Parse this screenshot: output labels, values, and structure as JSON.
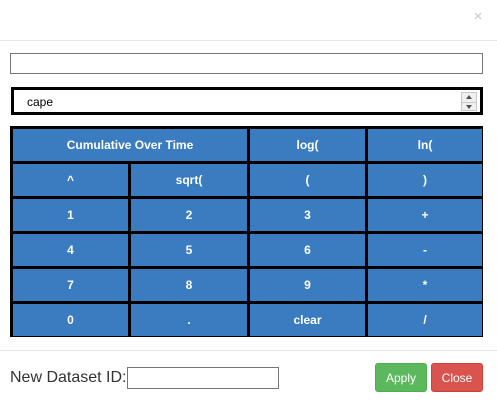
{
  "dialog": {
    "close_glyph": "×"
  },
  "formula": {
    "value": ""
  },
  "dataset_select": {
    "value": "cape"
  },
  "keypad": {
    "keys": [
      {
        "label": "Cumulative Over Time",
        "wide": true
      },
      {
        "label": "log("
      },
      {
        "label": "ln("
      },
      {
        "label": "^"
      },
      {
        "label": "sqrt("
      },
      {
        "label": "("
      },
      {
        "label": ")"
      },
      {
        "label": "1"
      },
      {
        "label": "2"
      },
      {
        "label": "3"
      },
      {
        "label": "+"
      },
      {
        "label": "4"
      },
      {
        "label": "5"
      },
      {
        "label": "6"
      },
      {
        "label": "-"
      },
      {
        "label": "7"
      },
      {
        "label": "8"
      },
      {
        "label": "9"
      },
      {
        "label": "*"
      },
      {
        "label": "0"
      },
      {
        "label": "."
      },
      {
        "label": "clear"
      },
      {
        "label": "/"
      }
    ]
  },
  "footer": {
    "dataset_id_label": "New Dataset ID:",
    "dataset_id_value": "",
    "apply_label": "Apply",
    "close_label": "Close"
  },
  "colors": {
    "key_bg": "#3a7cbf",
    "apply": "#5cb85c",
    "close": "#d9534f"
  }
}
